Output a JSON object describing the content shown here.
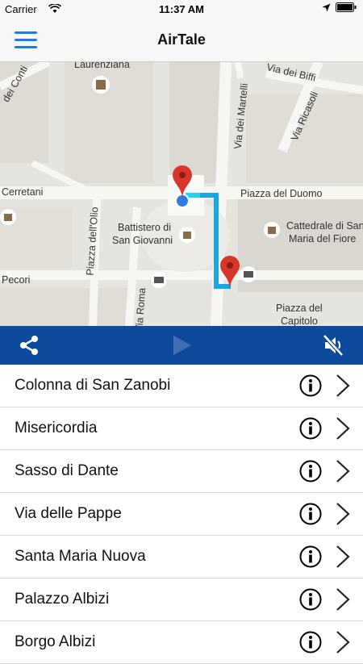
{
  "status_bar": {
    "carrier": "Carrier",
    "time": "11:37 AM"
  },
  "navbar": {
    "title": "AirTale"
  },
  "map": {
    "labels": [
      {
        "id": "laurenziana",
        "text": "Laurenziana"
      },
      {
        "id": "via-dei-biffi",
        "text": "Via dei Biffi"
      },
      {
        "id": "dei-conti",
        "text": "dei Conti"
      },
      {
        "id": "via-dei-martelli",
        "text": "Via dei Martelli"
      },
      {
        "id": "via-ricasoli",
        "text": "Via Ricasoli"
      },
      {
        "id": "cerretani",
        "text": "Cerretani"
      },
      {
        "id": "piazza-del-duomo",
        "text": "Piazza del Duomo"
      },
      {
        "id": "piazza-dell-olio",
        "text": "Piazza dell'Olio"
      },
      {
        "id": "battistero",
        "text": "Battistero di"
      },
      {
        "id": "san-giovanni",
        "text": "San Giovanni"
      },
      {
        "id": "cattedrale",
        "text": "Cattedrale di San"
      },
      {
        "id": "maria-del-fiore",
        "text": "Maria del Fiore"
      },
      {
        "id": "pecori",
        "text": "Pecori"
      },
      {
        "id": "via-roma",
        "text": "Via Roma"
      },
      {
        "id": "piazza-del",
        "text": "Piazza del"
      },
      {
        "id": "capitolo",
        "text": "Capitolo"
      }
    ]
  },
  "colors": {
    "accent": "#1e7be0",
    "toolbar": "#0d4a9e",
    "route": "#1aa6e0",
    "pin": "#d9362b"
  },
  "toolbar": {
    "icons": [
      "share-icon",
      "play-icon",
      "mute-icon"
    ]
  },
  "items": [
    {
      "label": "Colonna di San Zanobi"
    },
    {
      "label": "Misericordia"
    },
    {
      "label": "Sasso di Dante"
    },
    {
      "label": "Via delle Pappe"
    },
    {
      "label": "Santa Maria Nuova"
    },
    {
      "label": "Palazzo Albizi"
    },
    {
      "label": "Borgo Albizi"
    }
  ]
}
